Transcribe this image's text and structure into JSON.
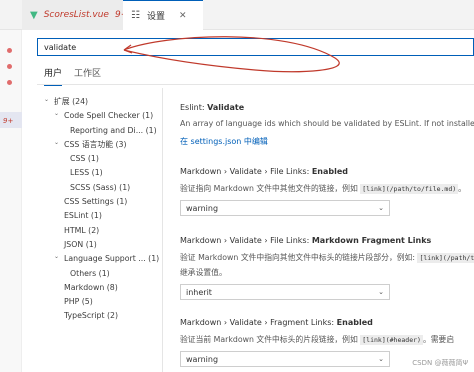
{
  "tabs": [
    {
      "label": "ScoresList.vue",
      "badge": "9+",
      "icon": "vue-icon"
    },
    {
      "label": "设置",
      "icon": "gear-icon",
      "close": "✕"
    }
  ],
  "edge": {
    "badge": "9+"
  },
  "search": {
    "value": "validate"
  },
  "scope_tabs": {
    "user": "用户",
    "workspace": "工作区"
  },
  "tree": [
    {
      "label": "扩展 (24)",
      "level": 0,
      "chevron": "⌄"
    },
    {
      "label": "Code Spell Checker (1)",
      "level": 1,
      "chevron": "⌄"
    },
    {
      "label": "Reporting and Di... (1)",
      "level": 2
    },
    {
      "label": "CSS 语言功能 (3)",
      "level": 1,
      "chevron": "⌄"
    },
    {
      "label": "CSS (1)",
      "level": 2
    },
    {
      "label": "LESS (1)",
      "level": 2
    },
    {
      "label": "SCSS (Sass) (1)",
      "level": 2
    },
    {
      "label": "CSS Settings (1)",
      "level": 1
    },
    {
      "label": "ESLint (1)",
      "level": 1
    },
    {
      "label": "HTML (2)",
      "level": 1
    },
    {
      "label": "JSON (1)",
      "level": 1
    },
    {
      "label": "Language Support ... (1)",
      "level": 1,
      "chevron": "⌄"
    },
    {
      "label": "Others (1)",
      "level": 2
    },
    {
      "label": "Markdown (8)",
      "level": 1
    },
    {
      "label": "PHP (5)",
      "level": 1
    },
    {
      "label": "TypeScript (2)",
      "level": 1
    }
  ],
  "settings": [
    {
      "prefix": "Eslint: ",
      "name": "Validate",
      "description": "An array of language ids which should be validated by ESLint. If not installed E",
      "link": "在 settings.json 中编辑"
    },
    {
      "prefix": "Markdown › Validate › File Links: ",
      "name": "Enabled",
      "desc_before": "验证指向 Markdown 文件中其他文件的链接，例如 ",
      "desc_code": "[link](/path/to/file.md)",
      "desc_after": "。",
      "value": "warning"
    },
    {
      "prefix": "Markdown › Validate › File Links: ",
      "name": "Markdown Fragment Links",
      "desc_before": "验证 Markdown 文件中指向其他文件中标头的链接片段部分，例如: ",
      "desc_code": "[link](/path/to",
      "desc_line2": "继承设置值。",
      "value": "inherit"
    },
    {
      "prefix": "Markdown › Validate › Fragment Links: ",
      "name": "Enabled",
      "desc_before": "验证当前 Markdown 文件中标头的片段链接，例如 ",
      "desc_code": "[link](#header)",
      "desc_after": "。需要启",
      "value": "warning"
    }
  ],
  "watermark": "CSDN @薇薇简Ψ"
}
